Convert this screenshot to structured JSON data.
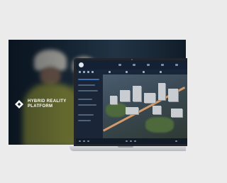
{
  "brand": {
    "line1": "HYBRID REALITY",
    "line2": "PLATFORM",
    "logo_icon": "diamond-logo-icon",
    "color": "#ffffff"
  },
  "app": {
    "accent": "#3b6fb0",
    "logo_icon": "app-logo-icon"
  },
  "colors": {
    "page_background": "#ebebeb",
    "hero_dark": "#0d1a27",
    "vest_yellow": "#b9b83a"
  }
}
